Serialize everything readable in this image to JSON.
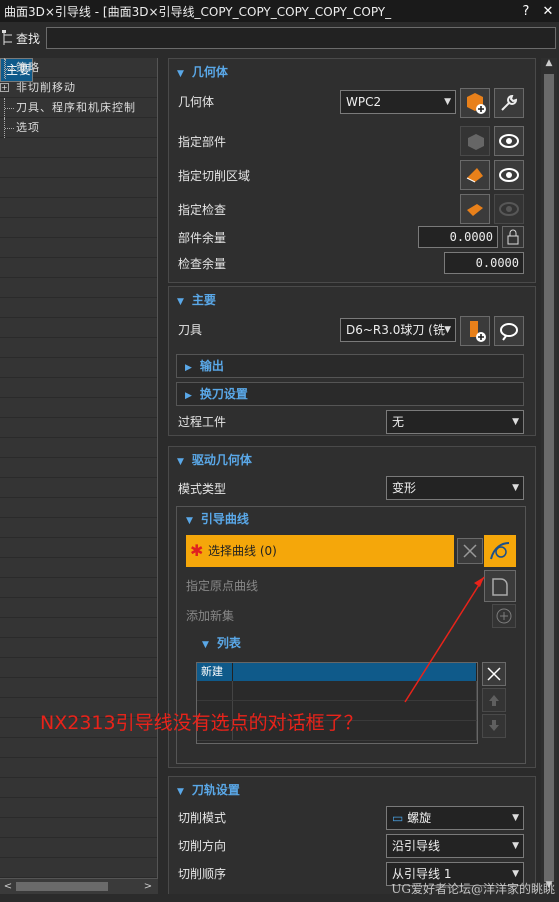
{
  "window": {
    "title": "曲面3D×引导线 - [曲面3D×引导线_COPY_COPY_COPY_COPY_COPY_",
    "help": "?",
    "close": "✕"
  },
  "search": {
    "label": "查找",
    "value": ""
  },
  "tree": {
    "items": [
      {
        "label": "主要",
        "selected": true
      },
      {
        "label": "策略"
      },
      {
        "label": "非切削移动",
        "expandable": true
      },
      {
        "label": "刀具、程序和机床控制"
      },
      {
        "label": "选项"
      }
    ]
  },
  "geometry": {
    "header": "几何体",
    "geom_label": "几何体",
    "geom_value": "WPC2",
    "part_label": "指定部件",
    "cut_area_label": "指定切削区域",
    "check_label": "指定检查",
    "part_stock_label": "部件余量",
    "part_stock_value": "0.0000",
    "check_stock_label": "检查余量",
    "check_stock_value": "0.0000"
  },
  "main_group": {
    "header": "主要",
    "tool_label": "刀具",
    "tool_value": "D6~R3.0球刀 (铣",
    "output": "输出",
    "tool_change": "换刀设置",
    "ipw_label": "过程工件",
    "ipw_value": "无"
  },
  "drive": {
    "header": "驱动几何体",
    "pattern_label": "模式类型",
    "pattern_value": "变形",
    "guide_header": "引导曲线",
    "select_curve": "选择曲线 (0)",
    "origin_curve": "指定原点曲线",
    "add_set": "添加新集",
    "list_header": "列表",
    "list_col": "新建"
  },
  "path": {
    "header": "刀轨设置",
    "cut_mode_label": "切削模式",
    "cut_mode_value": "螺旋",
    "cut_dir_label": "切削方向",
    "cut_dir_value": "沿引导线",
    "cut_order_label": "切削顺序",
    "cut_order_value": "从引导线 1"
  },
  "annotation": "NX2313引导线没有选点的对话框了？",
  "watermark": "UG爱好者论坛@洋洋家的眺眺",
  "colors": {
    "accent": "#5aa8e8",
    "selection": "#f5a70a",
    "highlight": "#0f5a8a",
    "annotation": "#e8231a"
  }
}
